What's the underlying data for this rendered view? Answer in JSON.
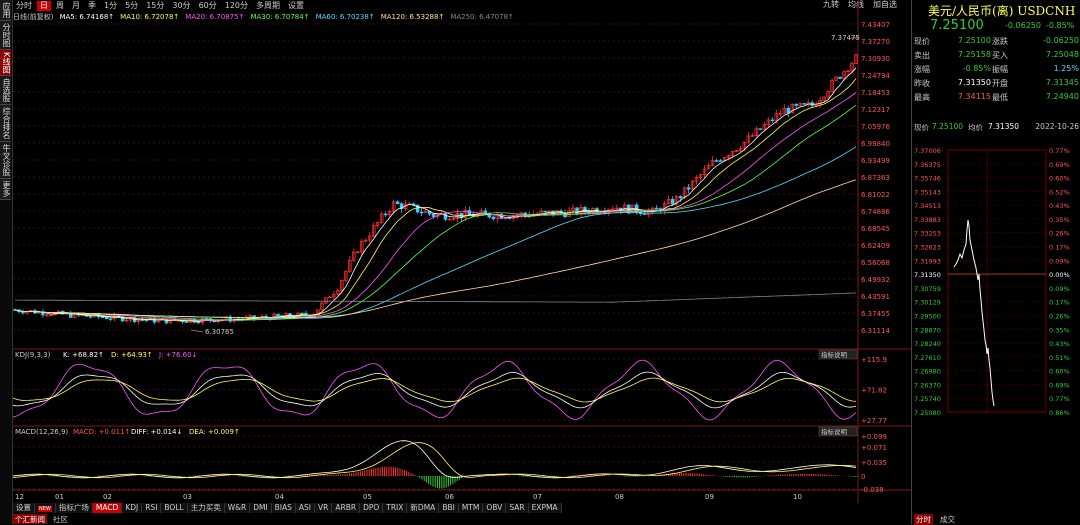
{
  "left_nav": [
    {
      "label": "应用"
    },
    {
      "label": "分时图"
    },
    {
      "label": "K线图",
      "active": true
    },
    {
      "label": "自选股"
    },
    {
      "label": "综合排名"
    },
    {
      "label": "牛叉诊股"
    },
    {
      "label": "更多"
    }
  ],
  "toolbar": {
    "items": [
      "分时",
      "日",
      "周",
      "月",
      "季",
      "1分",
      "5分",
      "15分",
      "30分",
      "60分",
      "120分",
      "多周期",
      "设置"
    ],
    "active_index": 1,
    "right_items": [
      "九转",
      "均线",
      "加自选"
    ]
  },
  "ma_legend": [
    {
      "label": "日线(前复权)",
      "color": "#cccccc"
    },
    {
      "label": "MA5: 6.74168↑",
      "color": "#ffffff"
    },
    {
      "label": "MA10: 6.72078↑",
      "color": "#ffff54"
    },
    {
      "label": "MA20: 6.70875↑",
      "color": "#ff54ff"
    },
    {
      "label": "MA30: 6.70784↑",
      "color": "#54ff54"
    },
    {
      "label": "MA60: 6.70238↑",
      "color": "#54dcff"
    },
    {
      "label": "MA120: 6.53288↑",
      "color": "#ffe0a0"
    },
    {
      "label": "MA250: 6.47078↑",
      "color": "#888888"
    }
  ],
  "main_chart": {
    "y_labels": [
      "7.43407",
      "7.37270",
      "7.30930",
      "7.24794",
      "7.18453",
      "7.12317",
      "7.05976",
      "6.99840",
      "6.93499",
      "6.87363",
      "6.81022",
      "6.74886",
      "6.68545",
      "6.62409",
      "6.56068",
      "6.49932",
      "6.43591",
      "6.37455",
      "6.31114"
    ],
    "high_label": "7.37475",
    "low_label": "6.30765"
  },
  "kdj": {
    "header": [
      {
        "label": "KDJ(9,3,3)",
        "color": "#cccccc"
      },
      {
        "label": "K: +68.82↑",
        "color": "#ffffff"
      },
      {
        "label": "D: +64.93↑",
        "color": "#ffff54"
      },
      {
        "label": "J: +76.60↓",
        "color": "#ff54ff"
      }
    ],
    "button": "指标说明",
    "y_labels": [
      "+115.9",
      "+71.82",
      "+27.77"
    ]
  },
  "macd": {
    "header": [
      {
        "label": "MACD(12,26,9)",
        "color": "#cccccc"
      },
      {
        "label": "MACD: +0.011↑",
        "color": "#ff5454"
      },
      {
        "label": "DIFF: +0.014↓",
        "color": "#ffffff"
      },
      {
        "label": "DEA: +0.009↑",
        "color": "#ffff54"
      }
    ],
    "button": "指标说明",
    "y_labels": [
      "+0.099",
      "+0.071",
      "+0.035",
      "0",
      "-0.038"
    ]
  },
  "x_labels": [
    "12",
    "01",
    "02",
    "03",
    "04",
    "05",
    "06",
    "07",
    "08",
    "09",
    "10"
  ],
  "bottom_tabs": [
    "设置",
    "NEW",
    "指标广场",
    "MACD",
    "KDJ",
    "RSI",
    "BOLL",
    "主力买卖",
    "W&R",
    "DMI",
    "BIAS",
    "ASI",
    "VR",
    "ARBR",
    "DPO",
    "TRIX",
    "新DMA",
    "BBI",
    "MTM",
    "OBV",
    "SAR",
    "EXPMA"
  ],
  "bottom_active": "MACD",
  "status_bar": [
    "个汇新闻",
    "社区"
  ],
  "quote": {
    "title": "美元/人民币(离) USDCNH",
    "price": "7.25100",
    "change": "-0.06250",
    "change_pct": "-0.85%",
    "rows": [
      {
        "l1": "现价",
        "v1": "7.25100",
        "c1": "#33cc33",
        "l2": "涨跌",
        "v2": "-0.06250",
        "c2": "#33cc33"
      },
      {
        "l1": "卖出",
        "v1": "7.25158",
        "c1": "#33cc33",
        "l2": "买入",
        "v2": "7.25048",
        "c2": "#33cc33"
      },
      {
        "l1": "涨幅",
        "v1": "-0.85%",
        "c1": "#33cc33",
        "l2": "振幅",
        "v2": "1.25%",
        "c2": "#54dcff"
      },
      {
        "l1": "昨收",
        "v1": "7.31350",
        "c1": "#ffffff",
        "l2": "开盘",
        "v2": "7.31345",
        "c2": "#33cc33"
      },
      {
        "l1": "最高",
        "v1": "7.34115",
        "c1": "#ff5454",
        "l2": "最低",
        "v2": "7.24940",
        "c2": "#33cc33"
      }
    ]
  },
  "mini_chart": {
    "hdr_price_label": "现价",
    "hdr_price": "7.25100",
    "hdr_avg_label": "均价",
    "hdr_avg": "7.31350",
    "hdr_date": "2022-10-26",
    "left_labels": [
      "7.37006",
      "7.36375",
      "7.35746",
      "7.35143",
      "7.34513",
      "7.33883",
      "7.33253",
      "7.32623",
      "7.31993",
      "7.31350",
      "7.30759",
      "7.30129",
      "7.29500",
      "7.28870",
      "7.28240",
      "7.27610",
      "7.26980",
      "7.26370",
      "7.25740",
      "7.25080"
    ],
    "right_labels": [
      "0.77%",
      "0.69%",
      "0.60%",
      "0.52%",
      "0.43%",
      "0.35%",
      "0.26%",
      "0.17%",
      "0.09%",
      "0.00%",
      "0.09%",
      "0.17%",
      "0.26%",
      "0.35%",
      "0.43%",
      "0.51%",
      "0.60%",
      "0.69%",
      "0.77%",
      "0.86%"
    ],
    "bottom_tabs": [
      "分时",
      "成交"
    ]
  },
  "colors": {
    "up": "#ff3333",
    "down": "#33ccff",
    "grid": "#7a1a1a",
    "mini_grid": "#8b0000"
  }
}
